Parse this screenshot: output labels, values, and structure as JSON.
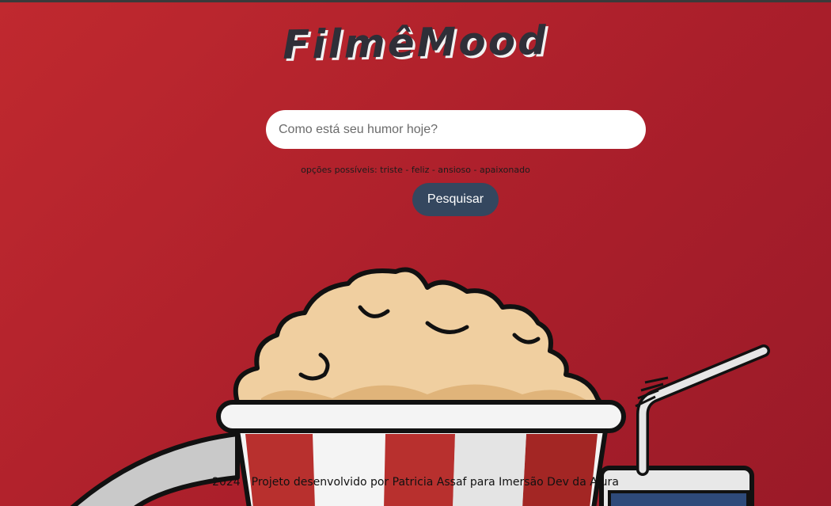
{
  "header": {
    "title": "FilmêMood"
  },
  "search": {
    "placeholder": "Como está seu humor hoje?",
    "value": "",
    "hint": "opções possíveis: triste - feliz - ansioso - apaixonado",
    "button_label": "Pesquisar"
  },
  "illustration": {
    "icon": "popcorn-and-soda-icon"
  },
  "footer": {
    "text": "2024 - Projeto desenvolvido por Patricia Assaf para Imersão Dev da Alura"
  },
  "colors": {
    "background": "#b3222d",
    "button": "#34475f",
    "popcorn": "#f0cfa0",
    "stripe_red": "#b8302e",
    "outline": "#111111"
  }
}
